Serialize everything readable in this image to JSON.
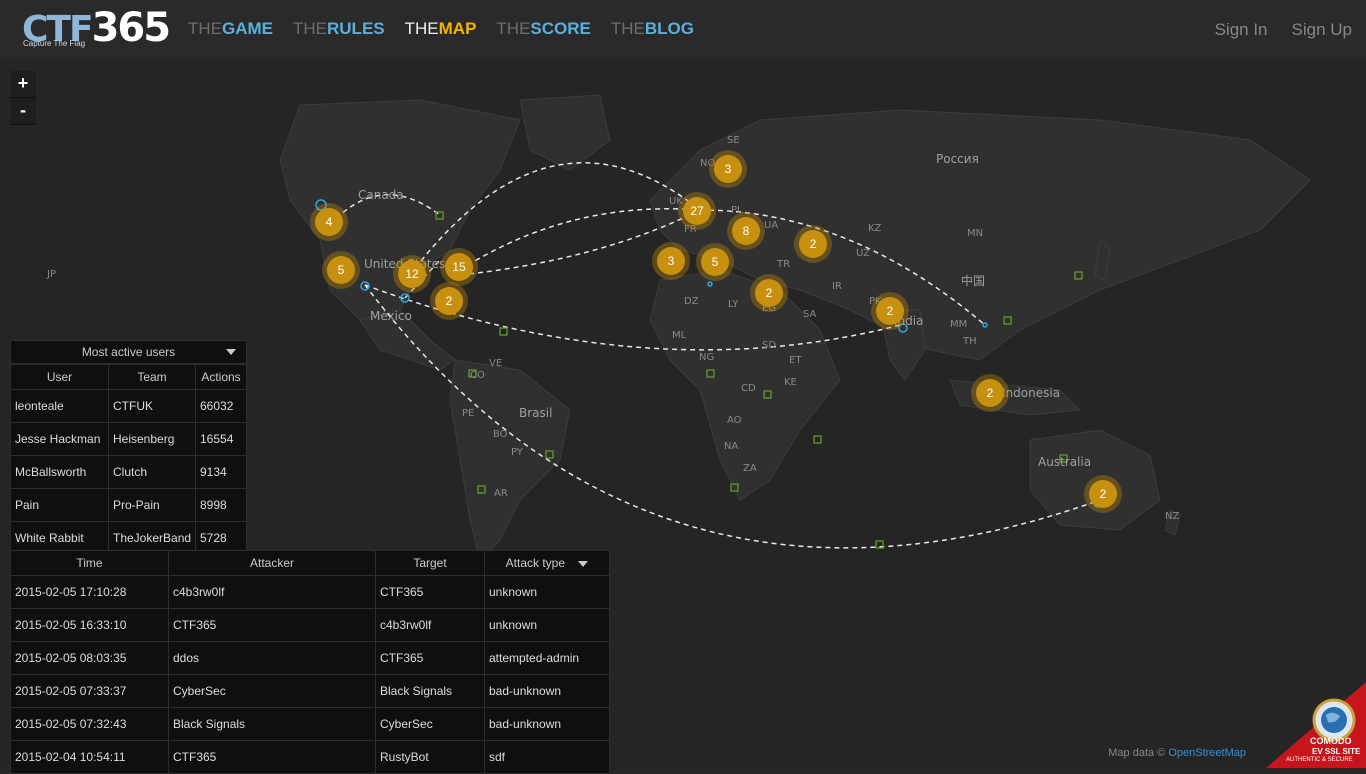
{
  "logo": {
    "main_a": "CTF",
    "main_b": "365",
    "tagline": "Capture The Flag"
  },
  "nav": [
    {
      "pre": "THE",
      "main": "GAME",
      "active": false
    },
    {
      "pre": "THE",
      "main": "RULES",
      "active": false
    },
    {
      "pre": "THE",
      "main": "MAP",
      "active": true
    },
    {
      "pre": "THE",
      "main": "SCORE",
      "active": false
    },
    {
      "pre": "THE",
      "main": "BLOG",
      "active": false
    }
  ],
  "auth": {
    "sign_in": "Sign In",
    "sign_up": "Sign Up"
  },
  "zoom": {
    "in": "+",
    "out": "-"
  },
  "map_labels": [
    "SE",
    "NO",
    "Россия",
    "Canada",
    "KZ",
    "MN",
    "JP",
    "United States",
    "PL",
    "UA",
    "TR",
    "IR",
    "中国",
    "México",
    "DZ",
    "LY",
    "EG",
    "SA",
    "PK",
    "India",
    "MM",
    "TH",
    "ML",
    "NG",
    "SD",
    "ET",
    "VE",
    "CO",
    "CD",
    "KE",
    "Indonesia",
    "PE",
    "Brasil",
    "BO",
    "PY",
    "AO",
    "NA",
    "ZA",
    "Australia",
    "AR",
    "NZ",
    "FR",
    "UK",
    "UZ"
  ],
  "clusters": [
    "3",
    "27",
    "8",
    "2",
    "4",
    "5",
    "12",
    "15",
    "2",
    "3",
    "5",
    "2",
    "2",
    "2",
    "2"
  ],
  "active_users": {
    "title": "Most active users",
    "headers": [
      "User",
      "Team",
      "Actions"
    ],
    "rows": [
      [
        "leonteale",
        "CTFUK",
        "66032"
      ],
      [
        "Jesse Hackman",
        "Heisenberg",
        "16554"
      ],
      [
        "McBallsworth",
        "Clutch",
        "9134"
      ],
      [
        "Pain",
        "Pro-Pain",
        "8998"
      ],
      [
        "White Rabbit",
        "TheJokerBand",
        "5728"
      ]
    ]
  },
  "attacks": {
    "headers": [
      "Time",
      "Attacker",
      "Target",
      "Attack type"
    ],
    "rows": [
      [
        "2015-02-05 17:10:28",
        "c4b3rw0lf",
        "CTF365",
        "unknown"
      ],
      [
        "2015-02-05 16:33:10",
        "CTF365",
        "c4b3rw0lf",
        "unknown"
      ],
      [
        "2015-02-05 08:03:35",
        "ddos",
        "CTF365",
        "attempted-admin"
      ],
      [
        "2015-02-05 07:33:37",
        "CyberSec",
        "Black Signals",
        "bad-unknown"
      ],
      [
        "2015-02-05 07:32:43",
        "Black Signals",
        "CyberSec",
        "bad-unknown"
      ],
      [
        "2015-02-04 10:54:11",
        "CTF365",
        "RustyBot",
        "sdf"
      ]
    ]
  },
  "attribution": {
    "text": "Map data ©",
    "link": "OpenStreetMap"
  },
  "ssl_badge": {
    "brand": "COMODO",
    "line1": "EV SSL SITE",
    "line2": "AUTHENTIC & SECURE"
  },
  "colors": {
    "accent_blue": "#5ab0dc",
    "active_yellow": "#f4b400",
    "cluster": "#c8900f"
  }
}
